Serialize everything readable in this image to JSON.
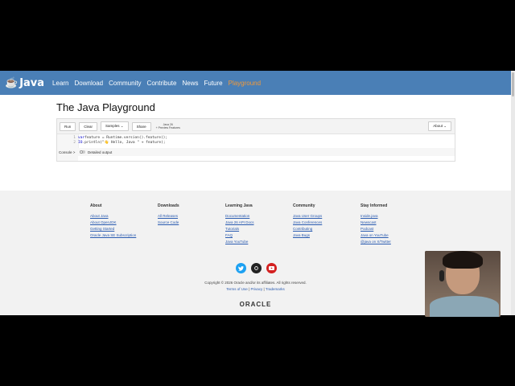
{
  "nav": {
    "logo_text": "Java",
    "items": [
      "Learn",
      "Download",
      "Community",
      "Contribute",
      "News",
      "Future",
      "Playground"
    ],
    "active": "Playground"
  },
  "page": {
    "title": "The Java Playground"
  },
  "toolbar": {
    "run": "Run",
    "clear": "Clear",
    "samples": "Samples ⌄",
    "share": "Share",
    "java_version": "Java 26",
    "preview": "+ Preview Features",
    "about": "About ⌄"
  },
  "editor": {
    "lines": [
      {
        "num": "1",
        "kw": "var",
        "text": " feature = Runtime.version().feature();"
      },
      {
        "num": "2",
        "kw": "IO",
        "text": ".println(\"👋 Hello, Java \" + feature);"
      }
    ]
  },
  "console": {
    "label": "Console >",
    "detailed_output": "Detailed output"
  },
  "footer": {
    "columns": [
      {
        "title": "About",
        "links": [
          "About Java",
          "About OpenJDK",
          "Getting Started",
          "Oracle Java SE Subscription"
        ]
      },
      {
        "title": "Downloads",
        "links": [
          "All Releases",
          "Source Code"
        ]
      },
      {
        "title": "Learning Java",
        "links": [
          "Documentation",
          "Java 26 API Docs",
          "Tutorials",
          "FAQ",
          "Java YouTube"
        ]
      },
      {
        "title": "Community",
        "links": [
          "Java User Groups",
          "Java Conferences",
          "Contributing",
          "Java Bugs"
        ]
      },
      {
        "title": "Stay Informed",
        "links": [
          "Inside.java",
          "Newscast",
          "Podcast",
          "Java on YouTube",
          "@java on X/Twitter"
        ]
      }
    ],
    "copyright": "Copyright © 2026 Oracle and/or its affiliates. All rights reserved.",
    "legal": {
      "terms": "Terms of Use",
      "privacy": "Privacy",
      "trademarks": "Trademarks"
    },
    "oracle": "ORACLE"
  },
  "colors": {
    "nav_bg": "#4a7fb6",
    "nav_active": "#f29a3a",
    "link": "#2a5bb0"
  }
}
